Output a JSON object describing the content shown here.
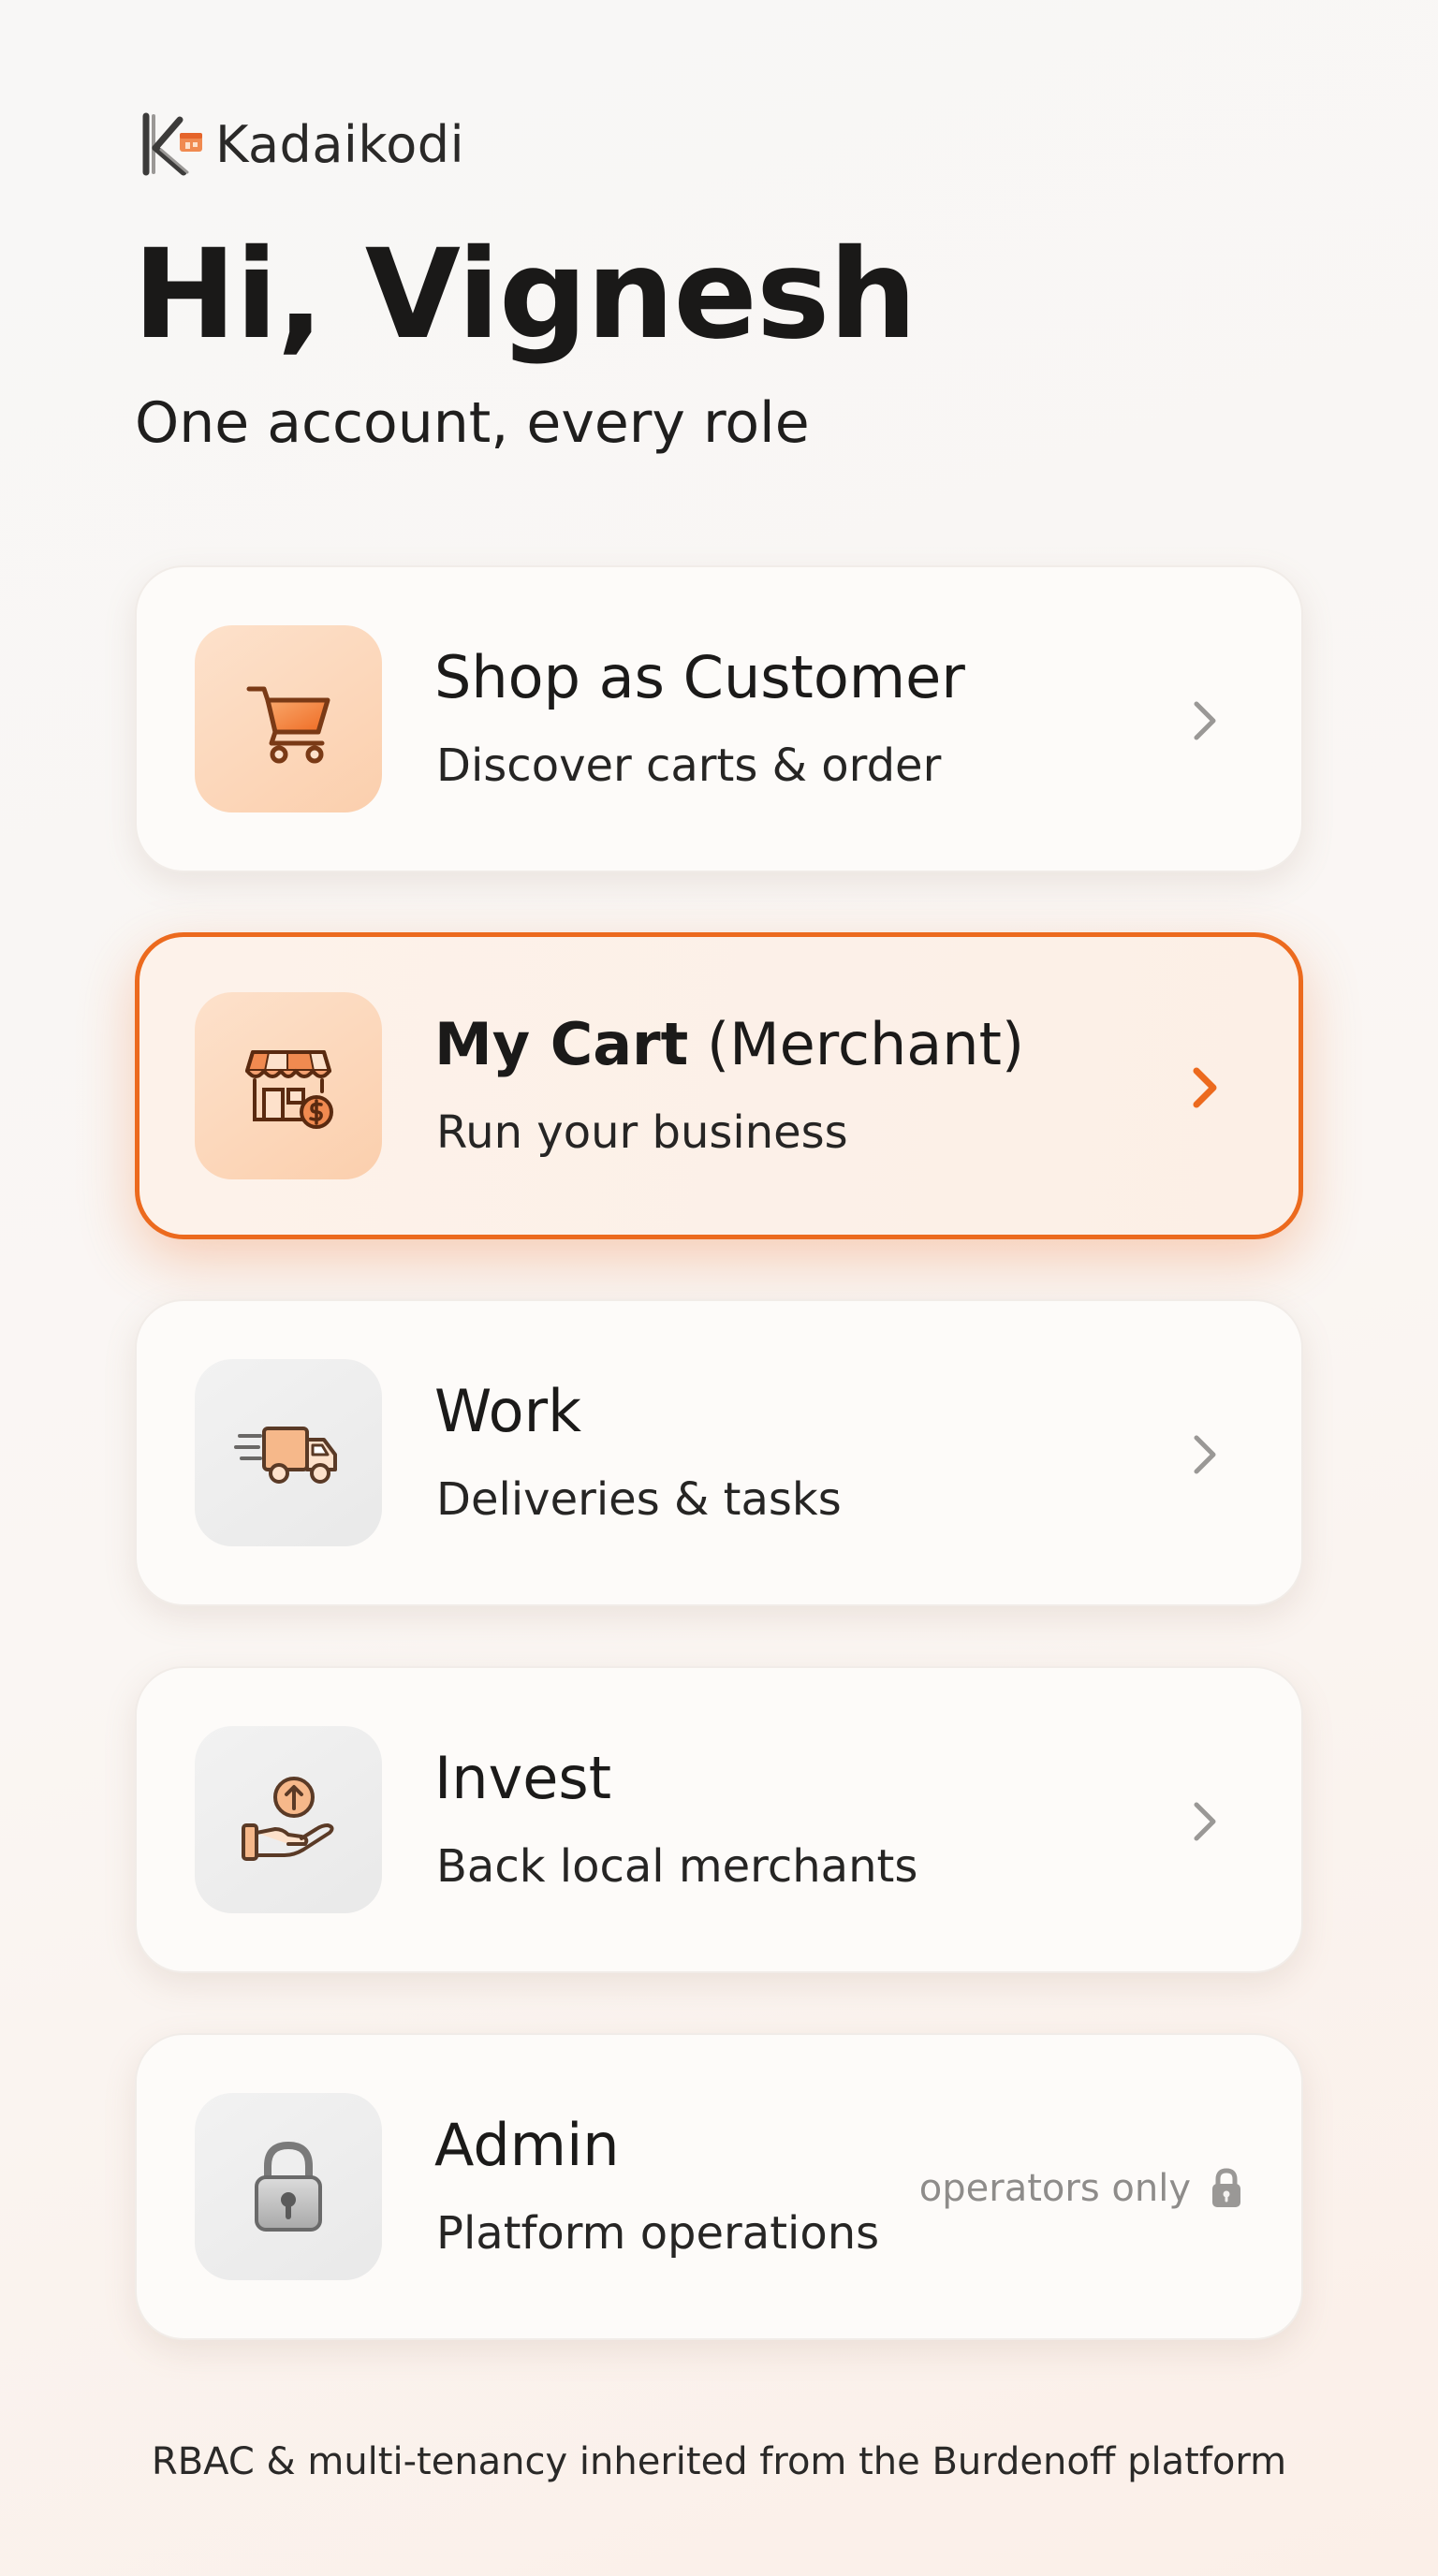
{
  "app": {
    "name": "Kadaikodi"
  },
  "header": {
    "greeting": "Hi, Vignesh",
    "tagline": "One account, every role"
  },
  "roles": [
    {
      "title": "Shop as Customer",
      "subtitle": "Discover carts & order",
      "icon": "cart-icon",
      "selected": false
    },
    {
      "title_bold": "My Cart",
      "title_rest": " (Merchant)",
      "subtitle": "Run your business",
      "icon": "storefront-icon",
      "selected": true
    },
    {
      "title": "Work",
      "subtitle": "Deliveries & tasks",
      "icon": "delivery-truck-icon",
      "selected": false
    },
    {
      "title": "Invest",
      "subtitle": "Back local merchants",
      "icon": "hand-coin-icon",
      "selected": false
    },
    {
      "title": "Admin",
      "subtitle": "Platform operations",
      "icon": "padlock-icon",
      "restricted_label": "operators only",
      "selected": false
    }
  ],
  "footer": {
    "text": "RBAC & multi-tenancy inherited from the Burdenoff platform"
  },
  "colors": {
    "accent": "#ec6a1e",
    "accent_light": "#fbcfad",
    "text": "#1b1a19",
    "muted": "#8e8c8a"
  }
}
